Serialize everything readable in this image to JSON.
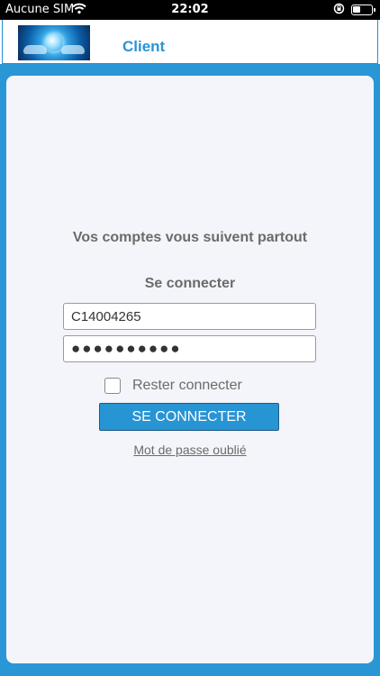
{
  "status_bar": {
    "carrier": "Aucune SIM",
    "time": "22:02"
  },
  "header": {
    "title": "Client",
    "logo_icon": "globe-hands-logo"
  },
  "login": {
    "tagline": "Vos comptes vous suivent partout",
    "title": "Se connecter",
    "username_value": "C14004265",
    "password_value": "●●●●●●●●●●",
    "remember_label": "Rester connecter",
    "remember_checked": false,
    "button_label": "SE CONNECTER",
    "forgot_link": "Mot de passe oublié"
  },
  "colors": {
    "accent": "#2997d6",
    "button": "#2794d4",
    "card_bg": "#f3f5fa",
    "text_muted": "#6b6b6b"
  }
}
